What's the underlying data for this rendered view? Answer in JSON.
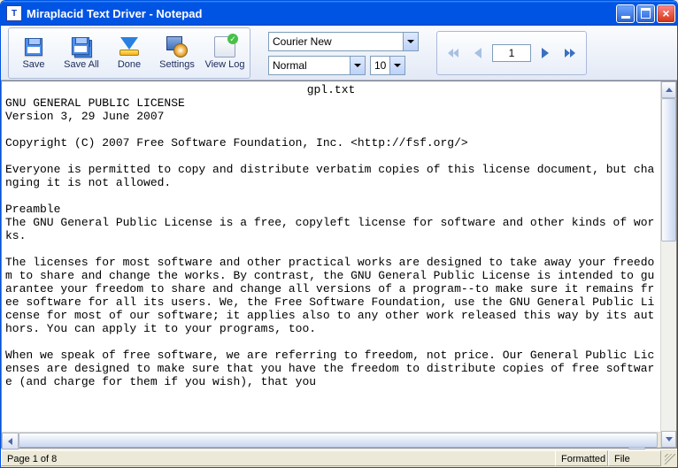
{
  "window": {
    "title": "Miraplacid Text Driver - Notepad"
  },
  "toolbar": {
    "save": "Save",
    "saveall": "Save All",
    "done": "Done",
    "settings": "Settings",
    "viewlog": "View Log"
  },
  "font": {
    "family": "Courier New",
    "style": "Normal",
    "size": "10"
  },
  "nav": {
    "page_value": "1"
  },
  "document": {
    "filename": "gpl.txt",
    "body": "GNU GENERAL PUBLIC LICENSE\nVersion 3, 29 June 2007\n\nCopyright (C) 2007 Free Software Foundation, Inc. <http://fsf.org/>\n\nEveryone is permitted to copy and distribute verbatim copies of this license document, but changing it is not allowed.\n\nPreamble\nThe GNU General Public License is a free, copyleft license for software and other kinds of works.\n\nThe licenses for most software and other practical works are designed to take away your freedom to share and change the works. By contrast, the GNU General Public License is intended to guarantee your freedom to share and change all versions of a program--to make sure it remains free software for all its users. We, the Free Software Foundation, use the GNU General Public License for most of our software; it applies also to any other work released this way by its authors. You can apply it to your programs, too.\n\nWhen we speak of free software, we are referring to freedom, not price. Our General Public Licenses are designed to make sure that you have the freedom to distribute copies of free software (and charge for them if you wish), that you"
  },
  "status": {
    "page": "Page 1 of 8",
    "formatted": "Formatted",
    "file": "File"
  }
}
